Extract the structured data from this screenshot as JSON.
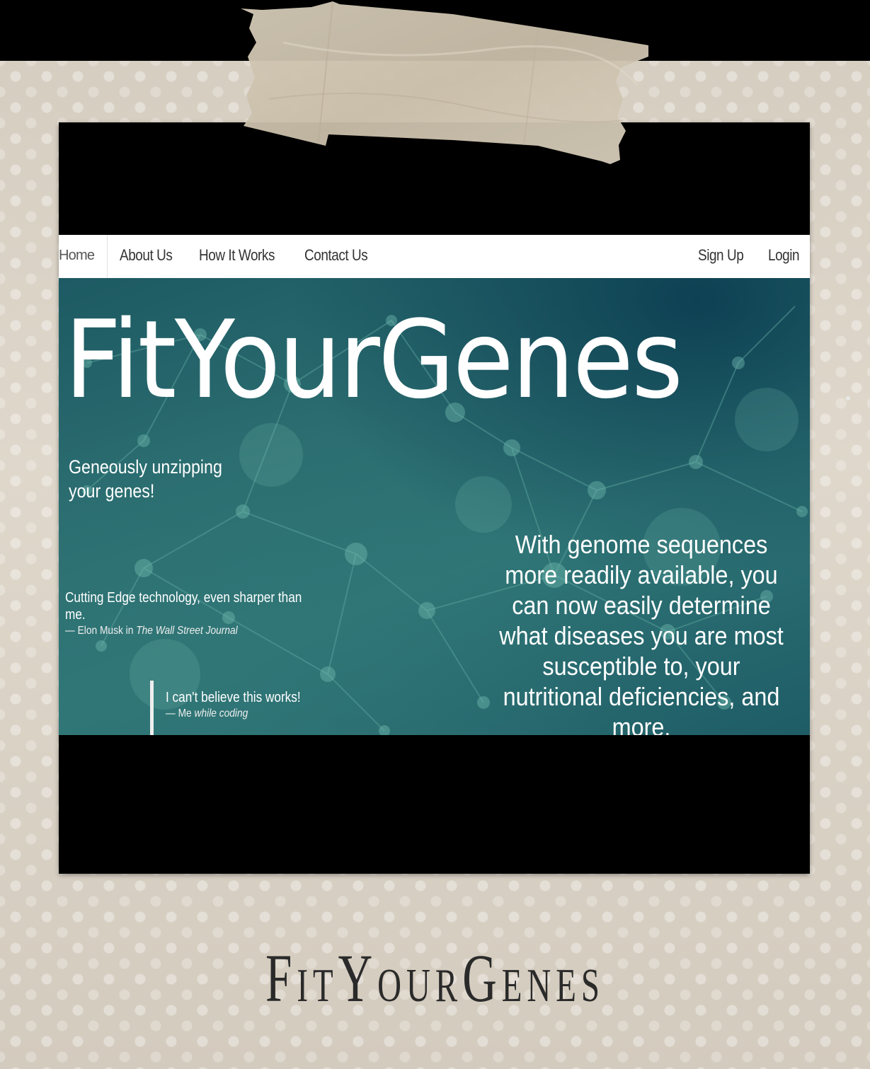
{
  "nav": {
    "left": [
      "Home",
      "About Us",
      "How It Works",
      "Contact Us"
    ],
    "right": [
      "Sign Up",
      "Login"
    ]
  },
  "hero": {
    "title": "FitYourGenes",
    "tagline": "Geneously unzipping your genes!",
    "quote1": {
      "text": "Cutting Edge technology, even sharper than me.",
      "author": "Elon Musk in",
      "source": "The Wall Street Journal"
    },
    "quote2": {
      "text": "I can't believe this works!",
      "author": "Me",
      "source": "while coding"
    },
    "blurb": "With genome sequences more readily available, you can now easily determine what diseases you are most susceptible to, your nutritional deficiencies, and more."
  },
  "footer": {
    "brand": "FitYourGenes"
  },
  "colors": {
    "hero_teal": "#2b6d70",
    "paper": "#ddd5c8",
    "nav_bg": "#ffffff"
  },
  "icons": {
    "tape": "masking-tape-graphic"
  }
}
